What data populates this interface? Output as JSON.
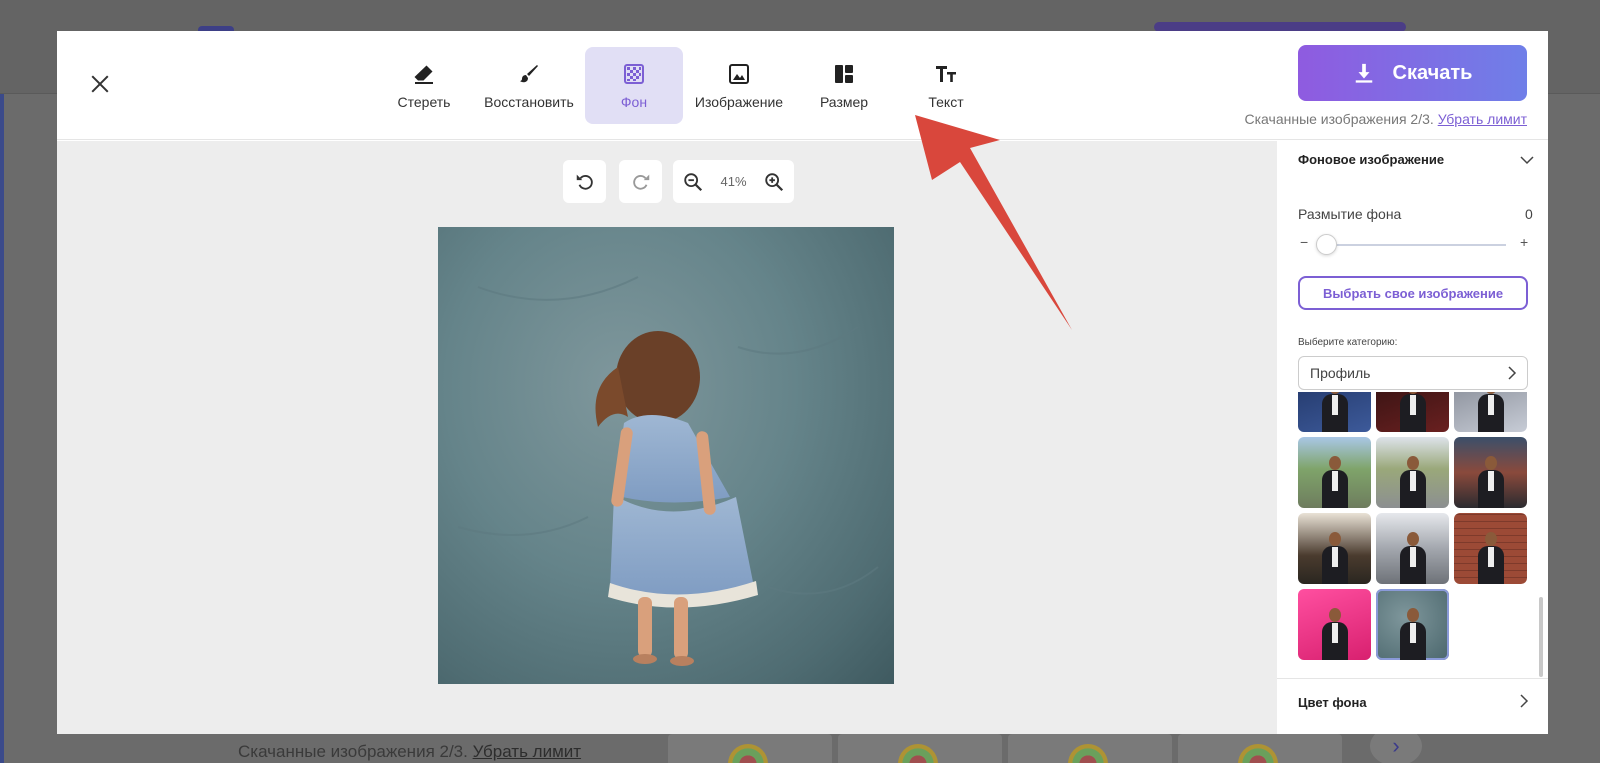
{
  "background_page": {
    "footer_text": "Скачанные изображения 2/3.",
    "footer_link": "Убрать лимит",
    "next_icon": "chevron-right-icon"
  },
  "toolbar": {
    "tools": [
      {
        "label": "Стереть",
        "icon": "eraser-icon"
      },
      {
        "label": "Восстановить",
        "icon": "brush-icon"
      },
      {
        "label": "Фон",
        "icon": "background-pattern-icon",
        "active": true
      },
      {
        "label": "Изображение",
        "icon": "image-icon"
      },
      {
        "label": "Размер",
        "icon": "layout-size-icon"
      },
      {
        "label": "Текст",
        "icon": "text-icon"
      }
    ],
    "download_label": "Скачать",
    "limit_text": "Скачанные изображения 2/3.",
    "limit_link": "Убрать лимит"
  },
  "canvas": {
    "zoom_level": "41%"
  },
  "panel": {
    "section_title": "Фоновое изображение",
    "blur_label": "Размытие фона",
    "blur_value": "0",
    "slider_minus": "−",
    "slider_plus": "+",
    "choose_button": "Выбрать свое изображение",
    "category_label": "Выберите категорию:",
    "category_selected": "Профиль",
    "footer_title": "Цвет фона"
  },
  "colors": {
    "accent": "#7c5fd4",
    "active_tool_bg": "#e1dff5",
    "annotation_arrow": "#d9473c"
  }
}
